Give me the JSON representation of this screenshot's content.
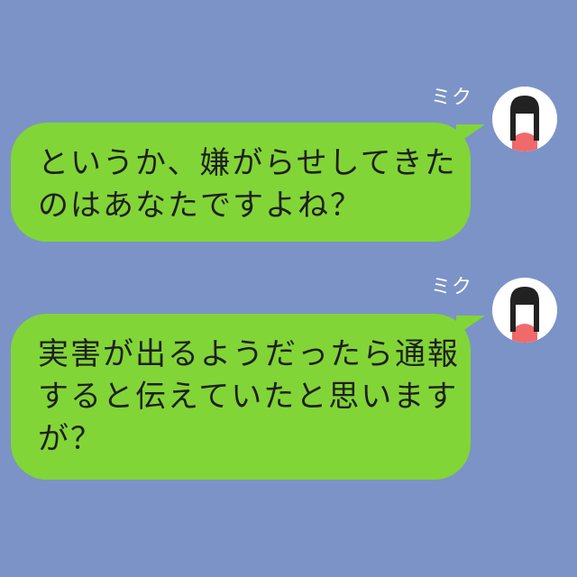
{
  "chat": {
    "background_color": "#7b93c7",
    "bubble_color": "#82d536",
    "messages": [
      {
        "sender": "ミク",
        "avatar_icon": "woman-avatar-icon",
        "lines": [
          "というか、嫌がらせしてきた",
          "のはあなたですよね？"
        ]
      },
      {
        "sender": "ミク",
        "avatar_icon": "woman-avatar-icon",
        "lines": [
          "実害が出るようだったら通報",
          "すると伝えていたと思います",
          "が？"
        ]
      }
    ]
  }
}
